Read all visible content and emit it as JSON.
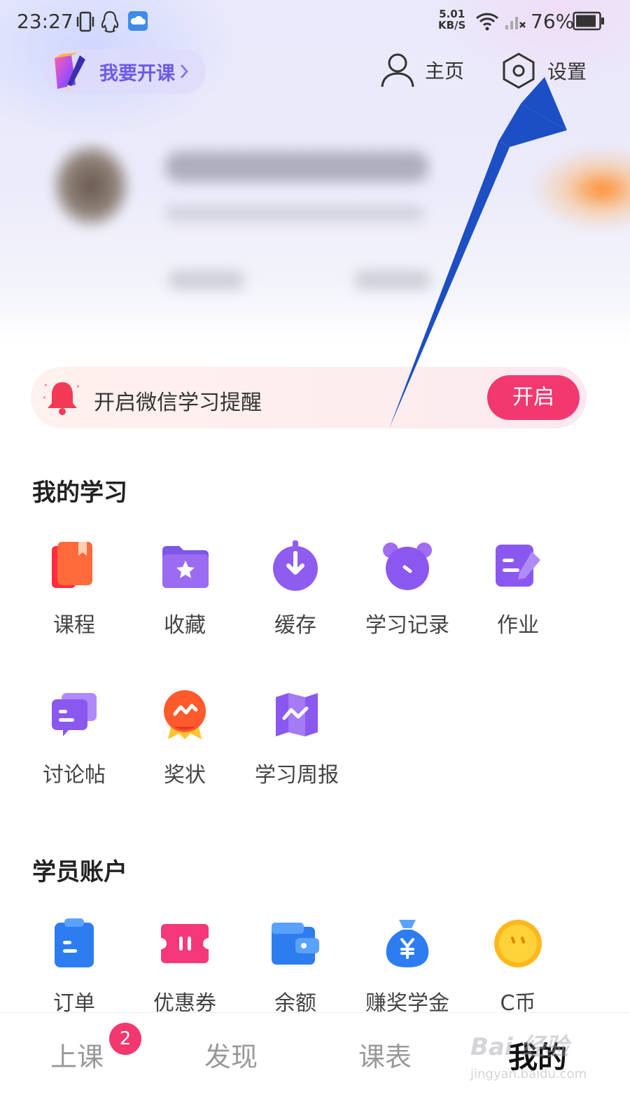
{
  "status_bar": {
    "time": "23:27",
    "net_speed_value": "5.01",
    "net_speed_unit": "KB/S",
    "battery": "76%"
  },
  "header": {
    "open_course_label": "我要开课",
    "home_label": "主页",
    "settings_label": "设置"
  },
  "reminder": {
    "text": "开启微信学习提醒",
    "button": "开启",
    "button_color": "#f2386f"
  },
  "my_learning": {
    "title": "我的学习",
    "items": [
      {
        "label": "课程",
        "icon": "book-icon"
      },
      {
        "label": "收藏",
        "icon": "star-folder-icon"
      },
      {
        "label": "缓存",
        "icon": "download-icon"
      },
      {
        "label": "学习记录",
        "icon": "alarm-clock-icon"
      },
      {
        "label": "作业",
        "icon": "homework-icon"
      },
      {
        "label": "讨论帖",
        "icon": "chat-icon"
      },
      {
        "label": "奖状",
        "icon": "medal-icon"
      },
      {
        "label": "学习周报",
        "icon": "weekly-report-icon"
      }
    ]
  },
  "account": {
    "title": "学员账户",
    "items": [
      {
        "label": "订单",
        "icon": "order-icon"
      },
      {
        "label": "优惠券",
        "icon": "coupon-icon"
      },
      {
        "label": "余额",
        "icon": "wallet-icon"
      },
      {
        "label": "赚奖学金",
        "icon": "money-bag-icon"
      },
      {
        "label": "C币",
        "icon": "coin-icon"
      }
    ]
  },
  "tab_bar": {
    "tabs": [
      {
        "label": "上课"
      },
      {
        "label": "发现"
      },
      {
        "label": "课表"
      },
      {
        "label": "我的"
      }
    ],
    "badge_count": "2",
    "active_index": 3
  },
  "watermark": {
    "text": "Bai 经验",
    "sub": "jingyan.baidu.com"
  },
  "colors": {
    "accent_purple": "#6b5be6",
    "badge_pink": "#f2386f",
    "annotation_arrow": "#1d4fc4"
  }
}
